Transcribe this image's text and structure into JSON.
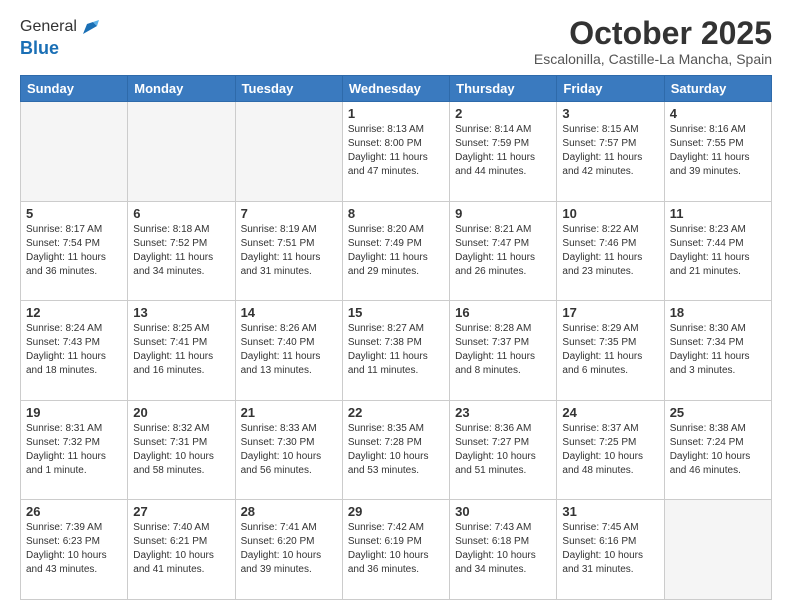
{
  "logo": {
    "general": "General",
    "blue": "Blue"
  },
  "title": "October 2025",
  "subtitle": "Escalonilla, Castille-La Mancha, Spain",
  "days_of_week": [
    "Sunday",
    "Monday",
    "Tuesday",
    "Wednesday",
    "Thursday",
    "Friday",
    "Saturday"
  ],
  "weeks": [
    [
      {
        "day": "",
        "info": ""
      },
      {
        "day": "",
        "info": ""
      },
      {
        "day": "",
        "info": ""
      },
      {
        "day": "1",
        "info": "Sunrise: 8:13 AM\nSunset: 8:00 PM\nDaylight: 11 hours and 47 minutes."
      },
      {
        "day": "2",
        "info": "Sunrise: 8:14 AM\nSunset: 7:59 PM\nDaylight: 11 hours and 44 minutes."
      },
      {
        "day": "3",
        "info": "Sunrise: 8:15 AM\nSunset: 7:57 PM\nDaylight: 11 hours and 42 minutes."
      },
      {
        "day": "4",
        "info": "Sunrise: 8:16 AM\nSunset: 7:55 PM\nDaylight: 11 hours and 39 minutes."
      }
    ],
    [
      {
        "day": "5",
        "info": "Sunrise: 8:17 AM\nSunset: 7:54 PM\nDaylight: 11 hours and 36 minutes."
      },
      {
        "day": "6",
        "info": "Sunrise: 8:18 AM\nSunset: 7:52 PM\nDaylight: 11 hours and 34 minutes."
      },
      {
        "day": "7",
        "info": "Sunrise: 8:19 AM\nSunset: 7:51 PM\nDaylight: 11 hours and 31 minutes."
      },
      {
        "day": "8",
        "info": "Sunrise: 8:20 AM\nSunset: 7:49 PM\nDaylight: 11 hours and 29 minutes."
      },
      {
        "day": "9",
        "info": "Sunrise: 8:21 AM\nSunset: 7:47 PM\nDaylight: 11 hours and 26 minutes."
      },
      {
        "day": "10",
        "info": "Sunrise: 8:22 AM\nSunset: 7:46 PM\nDaylight: 11 hours and 23 minutes."
      },
      {
        "day": "11",
        "info": "Sunrise: 8:23 AM\nSunset: 7:44 PM\nDaylight: 11 hours and 21 minutes."
      }
    ],
    [
      {
        "day": "12",
        "info": "Sunrise: 8:24 AM\nSunset: 7:43 PM\nDaylight: 11 hours and 18 minutes."
      },
      {
        "day": "13",
        "info": "Sunrise: 8:25 AM\nSunset: 7:41 PM\nDaylight: 11 hours and 16 minutes."
      },
      {
        "day": "14",
        "info": "Sunrise: 8:26 AM\nSunset: 7:40 PM\nDaylight: 11 hours and 13 minutes."
      },
      {
        "day": "15",
        "info": "Sunrise: 8:27 AM\nSunset: 7:38 PM\nDaylight: 11 hours and 11 minutes."
      },
      {
        "day": "16",
        "info": "Sunrise: 8:28 AM\nSunset: 7:37 PM\nDaylight: 11 hours and 8 minutes."
      },
      {
        "day": "17",
        "info": "Sunrise: 8:29 AM\nSunset: 7:35 PM\nDaylight: 11 hours and 6 minutes."
      },
      {
        "day": "18",
        "info": "Sunrise: 8:30 AM\nSunset: 7:34 PM\nDaylight: 11 hours and 3 minutes."
      }
    ],
    [
      {
        "day": "19",
        "info": "Sunrise: 8:31 AM\nSunset: 7:32 PM\nDaylight: 11 hours and 1 minute."
      },
      {
        "day": "20",
        "info": "Sunrise: 8:32 AM\nSunset: 7:31 PM\nDaylight: 10 hours and 58 minutes."
      },
      {
        "day": "21",
        "info": "Sunrise: 8:33 AM\nSunset: 7:30 PM\nDaylight: 10 hours and 56 minutes."
      },
      {
        "day": "22",
        "info": "Sunrise: 8:35 AM\nSunset: 7:28 PM\nDaylight: 10 hours and 53 minutes."
      },
      {
        "day": "23",
        "info": "Sunrise: 8:36 AM\nSunset: 7:27 PM\nDaylight: 10 hours and 51 minutes."
      },
      {
        "day": "24",
        "info": "Sunrise: 8:37 AM\nSunset: 7:25 PM\nDaylight: 10 hours and 48 minutes."
      },
      {
        "day": "25",
        "info": "Sunrise: 8:38 AM\nSunset: 7:24 PM\nDaylight: 10 hours and 46 minutes."
      }
    ],
    [
      {
        "day": "26",
        "info": "Sunrise: 7:39 AM\nSunset: 6:23 PM\nDaylight: 10 hours and 43 minutes."
      },
      {
        "day": "27",
        "info": "Sunrise: 7:40 AM\nSunset: 6:21 PM\nDaylight: 10 hours and 41 minutes."
      },
      {
        "day": "28",
        "info": "Sunrise: 7:41 AM\nSunset: 6:20 PM\nDaylight: 10 hours and 39 minutes."
      },
      {
        "day": "29",
        "info": "Sunrise: 7:42 AM\nSunset: 6:19 PM\nDaylight: 10 hours and 36 minutes."
      },
      {
        "day": "30",
        "info": "Sunrise: 7:43 AM\nSunset: 6:18 PM\nDaylight: 10 hours and 34 minutes."
      },
      {
        "day": "31",
        "info": "Sunrise: 7:45 AM\nSunset: 6:16 PM\nDaylight: 10 hours and 31 minutes."
      },
      {
        "day": "",
        "info": ""
      }
    ]
  ]
}
